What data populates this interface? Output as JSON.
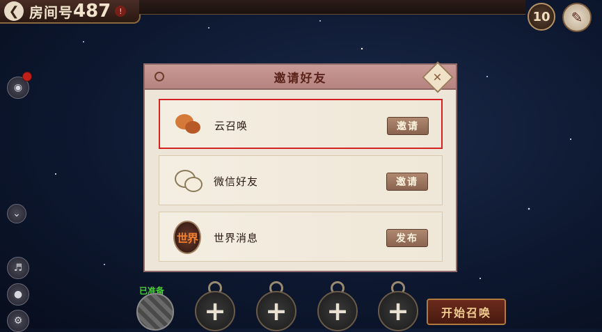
{
  "top_bar": {
    "room_label": "房间号",
    "room_number": "487",
    "info_mark": "!",
    "back_icon": "back-arrow-icon",
    "count": "10",
    "clean_icon": "broom-icon"
  },
  "side_icons": [
    "chat-icon",
    "chevron-down-icon",
    "speaker-icon",
    "microphone-icon",
    "settings-icon"
  ],
  "modal": {
    "title": "邀请好友",
    "close_icon": "close-icon",
    "options": [
      {
        "label": "云召唤",
        "button": "邀请",
        "icon": "cloud-chat-icon"
      },
      {
        "label": "微信好友",
        "button": "邀请",
        "icon": "wechat-icon"
      },
      {
        "label": "世界消息",
        "button": "发布",
        "icon_text": "世界"
      }
    ]
  },
  "bottom": {
    "ready_label": "已准备",
    "slot_plus": "+",
    "start_button": "开始召唤"
  },
  "colors": {
    "selected_border": "#d42020",
    "modal_header": "#c89a96",
    "button": "#9a7460"
  }
}
